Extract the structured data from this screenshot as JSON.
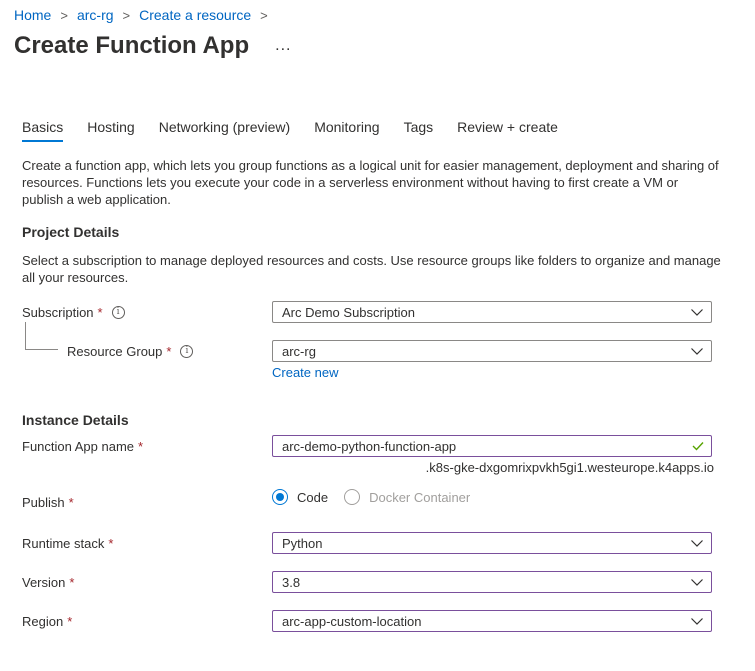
{
  "breadcrumb": {
    "items": [
      "Home",
      "arc-rg",
      "Create a resource"
    ],
    "separator": ">"
  },
  "page": {
    "title": "Create Function App",
    "more": "..."
  },
  "tabs": [
    "Basics",
    "Hosting",
    "Networking (preview)",
    "Monitoring",
    "Tags",
    "Review + create"
  ],
  "active_tab": "Basics",
  "intro": "Create a function app, which lets you group functions as a logical unit for easier management, deployment and sharing of resources. Functions lets you execute your code in a serverless environment without having to first create a VM or publish a web application.",
  "project": {
    "heading": "Project Details",
    "description": "Select a subscription to manage deployed resources and costs. Use resource groups like folders to organize and manage all your resources.",
    "subscription_label": "Subscription",
    "subscription_value": "Arc Demo Subscription",
    "resource_group_label": "Resource Group",
    "resource_group_value": "arc-rg",
    "create_new": "Create new"
  },
  "instance": {
    "heading": "Instance Details",
    "name_label": "Function App name",
    "name_value": "arc-demo-python-function-app",
    "name_suffix": ".k8s-gke-dxgomrixpvkh5gi1.westeurope.k4apps.io",
    "publish_label": "Publish",
    "publish_options": [
      "Code",
      "Docker Container"
    ],
    "publish_selected": "Code",
    "runtime_label": "Runtime stack",
    "runtime_value": "Python",
    "version_label": "Version",
    "version_value": "3.8",
    "region_label": "Region",
    "region_value": "arc-app-custom-location"
  },
  "required_marker": "*",
  "info_glyph": "i",
  "colors": {
    "link": "#0066c2",
    "accent": "#0078d4",
    "required": "#a4262c",
    "valid": "#57a300",
    "focus_border": "#7a4f9c"
  }
}
